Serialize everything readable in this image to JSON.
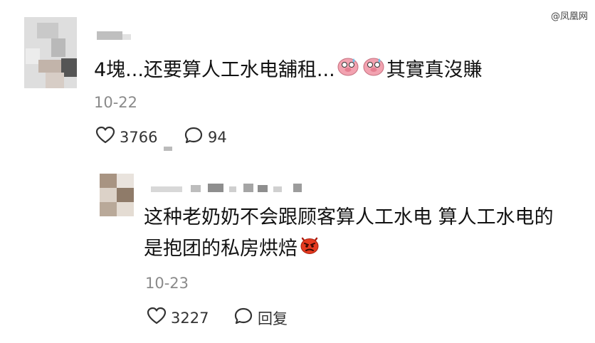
{
  "watermark": "@凤凰网",
  "comment1": {
    "text_before_emoji": "4塊...还要算人工水电舖租...",
    "text_after_emoji": "其實真沒賺",
    "date": "10-22",
    "likes": "3766",
    "replies": "94"
  },
  "comment2": {
    "line1": "这种老奶奶不会跟顾客算人工水电 算人工水电的",
    "line2": "是抱团的私房烘焙",
    "date": "10-23",
    "likes": "3227",
    "reply_label": "回复"
  },
  "colors": {
    "text": "#121212",
    "meta": "#8a8a8a",
    "emoji_pink": "#f2a2b0",
    "emoji_red": "#e53a1f"
  }
}
